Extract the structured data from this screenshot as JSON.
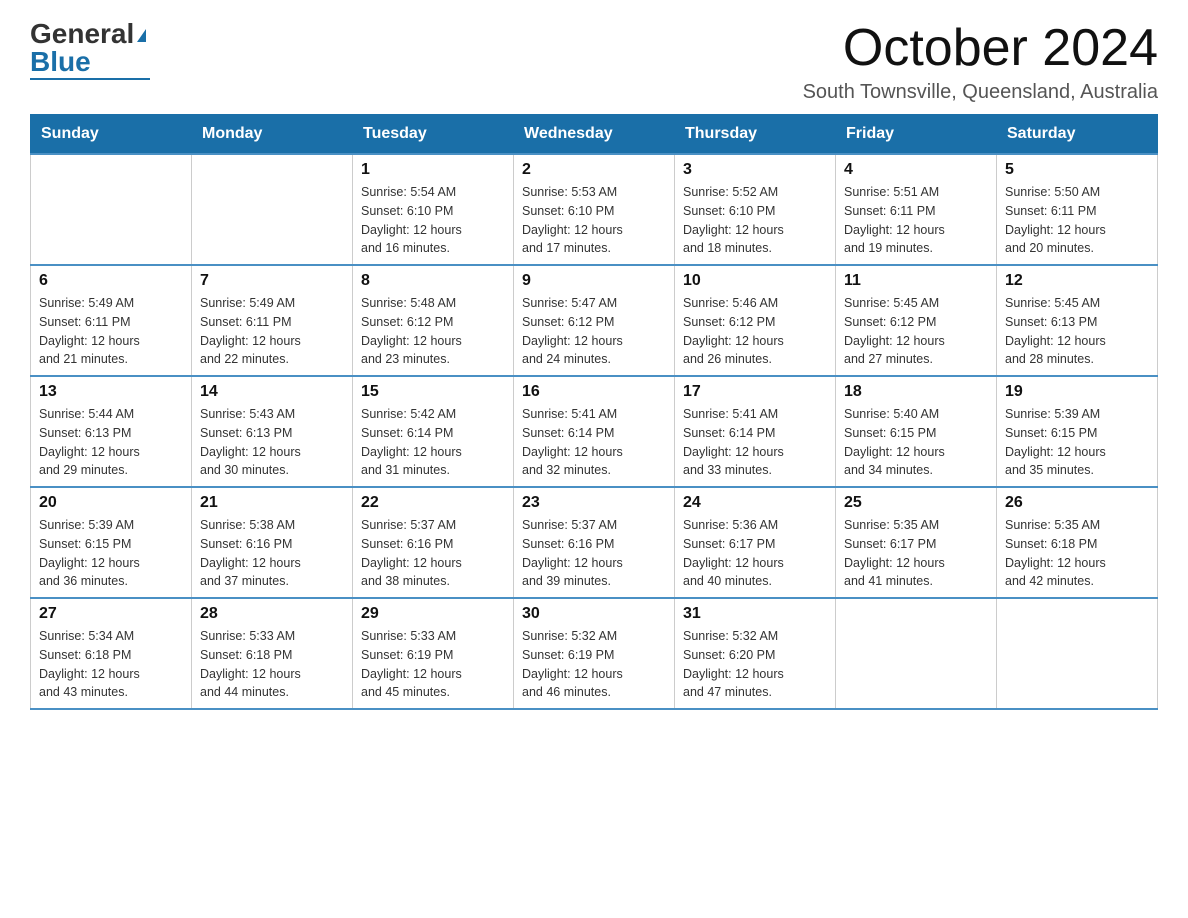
{
  "logo": {
    "general": "General",
    "blue": "Blue"
  },
  "title": "October 2024",
  "location": "South Townsville, Queensland, Australia",
  "weekdays": [
    "Sunday",
    "Monday",
    "Tuesday",
    "Wednesday",
    "Thursday",
    "Friday",
    "Saturday"
  ],
  "weeks": [
    [
      {
        "day": "",
        "info": ""
      },
      {
        "day": "",
        "info": ""
      },
      {
        "day": "1",
        "info": "Sunrise: 5:54 AM\nSunset: 6:10 PM\nDaylight: 12 hours\nand 16 minutes."
      },
      {
        "day": "2",
        "info": "Sunrise: 5:53 AM\nSunset: 6:10 PM\nDaylight: 12 hours\nand 17 minutes."
      },
      {
        "day": "3",
        "info": "Sunrise: 5:52 AM\nSunset: 6:10 PM\nDaylight: 12 hours\nand 18 minutes."
      },
      {
        "day": "4",
        "info": "Sunrise: 5:51 AM\nSunset: 6:11 PM\nDaylight: 12 hours\nand 19 minutes."
      },
      {
        "day": "5",
        "info": "Sunrise: 5:50 AM\nSunset: 6:11 PM\nDaylight: 12 hours\nand 20 minutes."
      }
    ],
    [
      {
        "day": "6",
        "info": "Sunrise: 5:49 AM\nSunset: 6:11 PM\nDaylight: 12 hours\nand 21 minutes."
      },
      {
        "day": "7",
        "info": "Sunrise: 5:49 AM\nSunset: 6:11 PM\nDaylight: 12 hours\nand 22 minutes."
      },
      {
        "day": "8",
        "info": "Sunrise: 5:48 AM\nSunset: 6:12 PM\nDaylight: 12 hours\nand 23 minutes."
      },
      {
        "day": "9",
        "info": "Sunrise: 5:47 AM\nSunset: 6:12 PM\nDaylight: 12 hours\nand 24 minutes."
      },
      {
        "day": "10",
        "info": "Sunrise: 5:46 AM\nSunset: 6:12 PM\nDaylight: 12 hours\nand 26 minutes."
      },
      {
        "day": "11",
        "info": "Sunrise: 5:45 AM\nSunset: 6:12 PM\nDaylight: 12 hours\nand 27 minutes."
      },
      {
        "day": "12",
        "info": "Sunrise: 5:45 AM\nSunset: 6:13 PM\nDaylight: 12 hours\nand 28 minutes."
      }
    ],
    [
      {
        "day": "13",
        "info": "Sunrise: 5:44 AM\nSunset: 6:13 PM\nDaylight: 12 hours\nand 29 minutes."
      },
      {
        "day": "14",
        "info": "Sunrise: 5:43 AM\nSunset: 6:13 PM\nDaylight: 12 hours\nand 30 minutes."
      },
      {
        "day": "15",
        "info": "Sunrise: 5:42 AM\nSunset: 6:14 PM\nDaylight: 12 hours\nand 31 minutes."
      },
      {
        "day": "16",
        "info": "Sunrise: 5:41 AM\nSunset: 6:14 PM\nDaylight: 12 hours\nand 32 minutes."
      },
      {
        "day": "17",
        "info": "Sunrise: 5:41 AM\nSunset: 6:14 PM\nDaylight: 12 hours\nand 33 minutes."
      },
      {
        "day": "18",
        "info": "Sunrise: 5:40 AM\nSunset: 6:15 PM\nDaylight: 12 hours\nand 34 minutes."
      },
      {
        "day": "19",
        "info": "Sunrise: 5:39 AM\nSunset: 6:15 PM\nDaylight: 12 hours\nand 35 minutes."
      }
    ],
    [
      {
        "day": "20",
        "info": "Sunrise: 5:39 AM\nSunset: 6:15 PM\nDaylight: 12 hours\nand 36 minutes."
      },
      {
        "day": "21",
        "info": "Sunrise: 5:38 AM\nSunset: 6:16 PM\nDaylight: 12 hours\nand 37 minutes."
      },
      {
        "day": "22",
        "info": "Sunrise: 5:37 AM\nSunset: 6:16 PM\nDaylight: 12 hours\nand 38 minutes."
      },
      {
        "day": "23",
        "info": "Sunrise: 5:37 AM\nSunset: 6:16 PM\nDaylight: 12 hours\nand 39 minutes."
      },
      {
        "day": "24",
        "info": "Sunrise: 5:36 AM\nSunset: 6:17 PM\nDaylight: 12 hours\nand 40 minutes."
      },
      {
        "day": "25",
        "info": "Sunrise: 5:35 AM\nSunset: 6:17 PM\nDaylight: 12 hours\nand 41 minutes."
      },
      {
        "day": "26",
        "info": "Sunrise: 5:35 AM\nSunset: 6:18 PM\nDaylight: 12 hours\nand 42 minutes."
      }
    ],
    [
      {
        "day": "27",
        "info": "Sunrise: 5:34 AM\nSunset: 6:18 PM\nDaylight: 12 hours\nand 43 minutes."
      },
      {
        "day": "28",
        "info": "Sunrise: 5:33 AM\nSunset: 6:18 PM\nDaylight: 12 hours\nand 44 minutes."
      },
      {
        "day": "29",
        "info": "Sunrise: 5:33 AM\nSunset: 6:19 PM\nDaylight: 12 hours\nand 45 minutes."
      },
      {
        "day": "30",
        "info": "Sunrise: 5:32 AM\nSunset: 6:19 PM\nDaylight: 12 hours\nand 46 minutes."
      },
      {
        "day": "31",
        "info": "Sunrise: 5:32 AM\nSunset: 6:20 PM\nDaylight: 12 hours\nand 47 minutes."
      },
      {
        "day": "",
        "info": ""
      },
      {
        "day": "",
        "info": ""
      }
    ]
  ]
}
